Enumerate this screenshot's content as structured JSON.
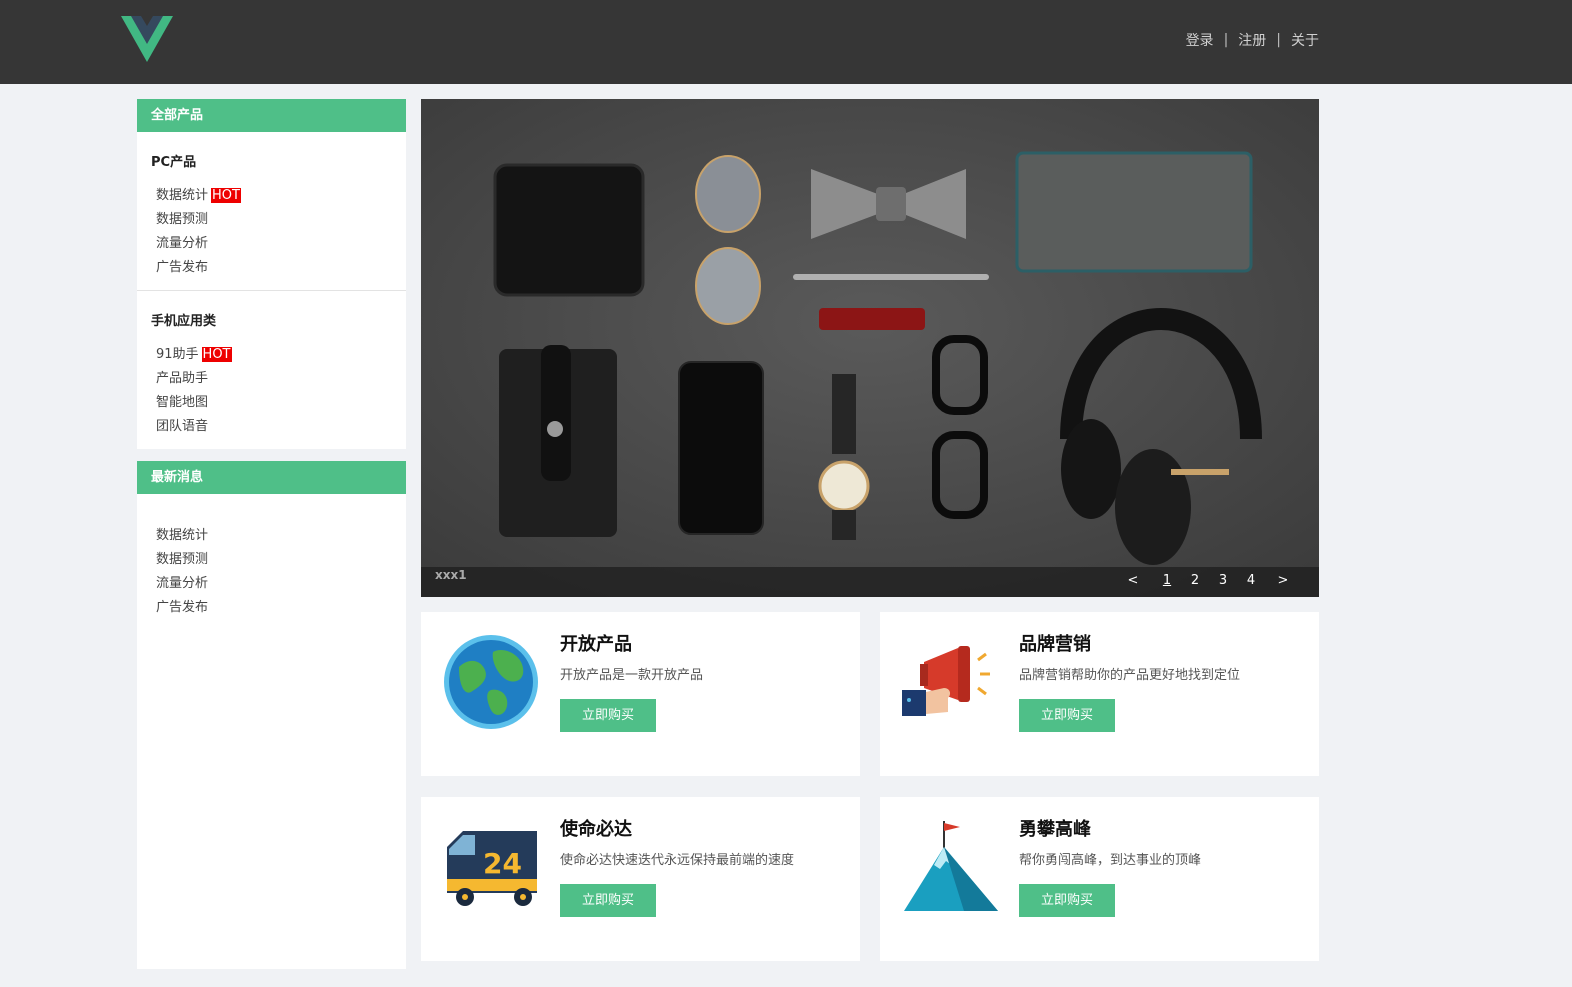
{
  "header": {
    "logo": "vue-logo",
    "nav": [
      "登录",
      "注册",
      "关于"
    ],
    "separator": "|"
  },
  "sidebar": {
    "products_title": "全部产品",
    "groups": [
      {
        "title": "PC产品",
        "items": [
          "数据统计",
          "数据预测",
          "流量分析",
          "广告发布"
        ],
        "hot_item": "数据统计"
      },
      {
        "title": "手机应用类",
        "items": [
          "91助手",
          "产品助手",
          "智能地图",
          "团队语音"
        ],
        "hot_item": "91助手"
      }
    ],
    "hot_label": "HOT",
    "news_title": "最新消息",
    "news_items": [
      "数据统计",
      "数据预测",
      "流量分析",
      "广告发布"
    ]
  },
  "banner": {
    "caption": "xxx1",
    "prev": "<",
    "next": ">",
    "pages": [
      "1",
      "2",
      "3",
      "4"
    ],
    "active_page": 1
  },
  "cards": [
    {
      "title": "开放产品",
      "desc": "开放产品是一款开放产品",
      "button": "立即购买",
      "icon": "globe-icon"
    },
    {
      "title": "品牌营销",
      "desc": "品牌营销帮助你的产品更好地找到定位",
      "button": "立即购买",
      "icon": "megaphone-icon"
    },
    {
      "title": "使命必达",
      "desc": "使命必达快速迭代永远保持最前端的速度",
      "button": "立即购买",
      "icon": "delivery-truck-icon"
    },
    {
      "title": "勇攀高峰",
      "desc": "帮你勇闯高峰，到达事业的顶峰",
      "button": "立即购买",
      "icon": "mountain-flag-icon"
    }
  ],
  "colors": {
    "accent": "#4fbf88",
    "header_bg": "#363636",
    "hot": "#ee0000"
  }
}
